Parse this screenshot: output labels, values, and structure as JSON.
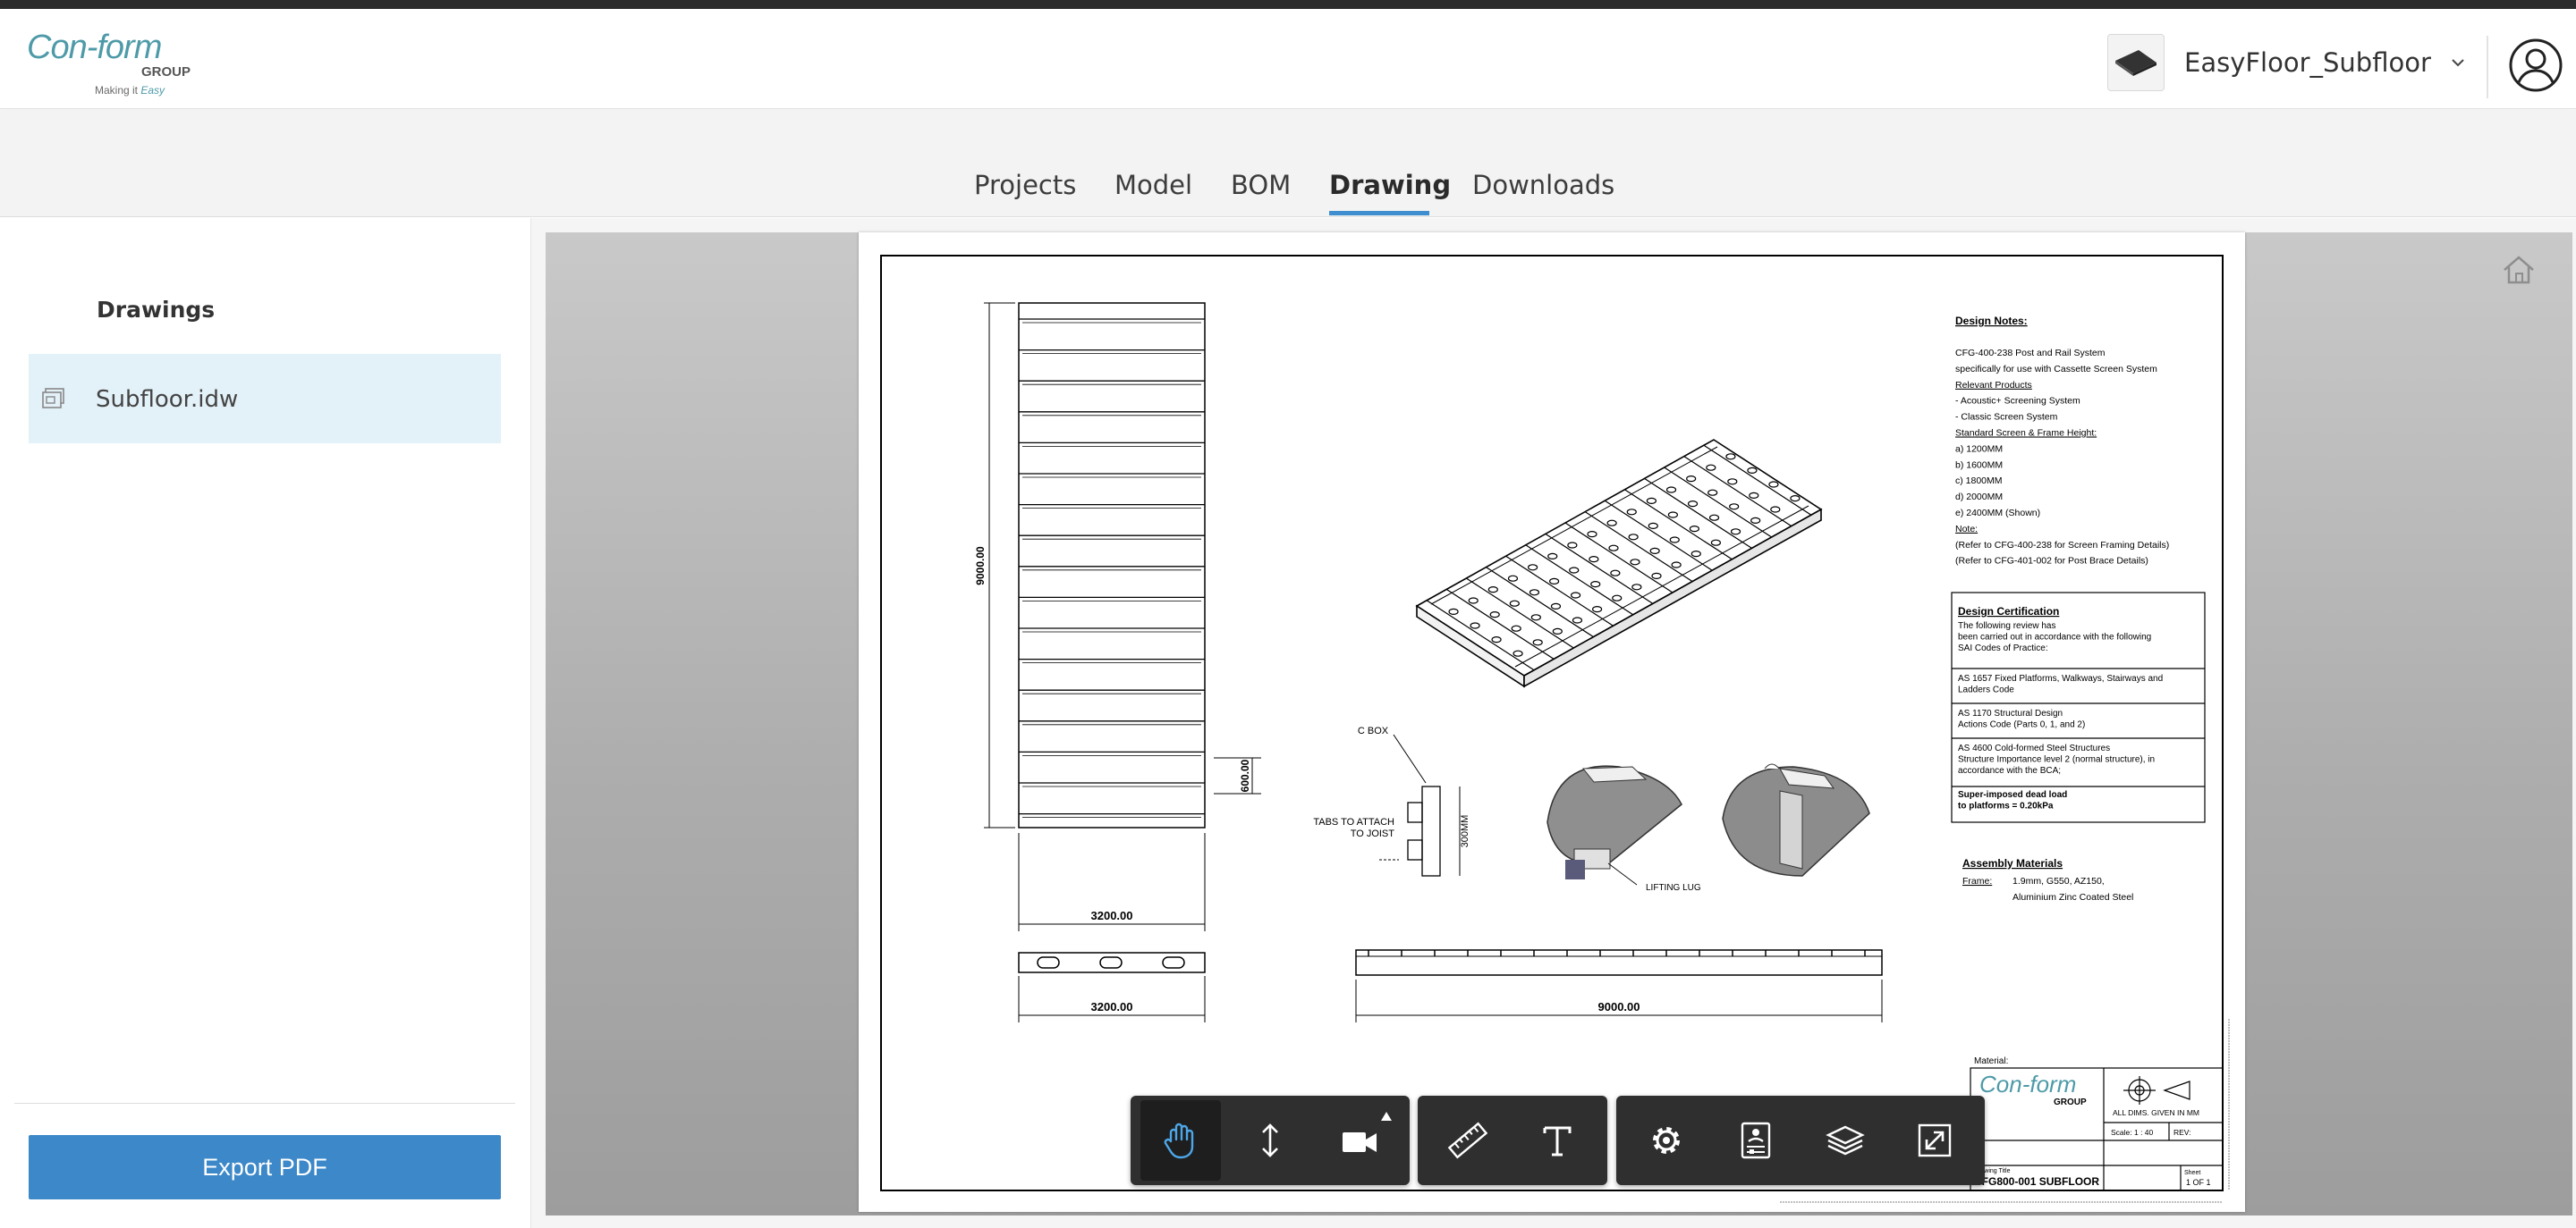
{
  "header": {
    "logo_main": "Con-form",
    "logo_group": "GROUP",
    "logo_tag_a": "Making it",
    "logo_tag_b": "Easy",
    "project_name": "EasyFloor_Subfloor"
  },
  "tabs": [
    {
      "label": "Projects"
    },
    {
      "label": "Model"
    },
    {
      "label": "BOM"
    },
    {
      "label": "Drawing"
    },
    {
      "label": "Downloads"
    }
  ],
  "active_tab": "Drawing",
  "sidebar": {
    "title": "Drawings",
    "items": [
      {
        "label": "Subfloor.idw"
      }
    ],
    "export_label": "Export PDF"
  },
  "drawing": {
    "dim_height": "9000.00",
    "dim_spacing": "600.00",
    "dim_width": "3200.00",
    "dim_width2": "3200.00",
    "dim_length": "9000.00",
    "label_cbox": "C BOX",
    "label_tabs_1": "TABS TO ATTACH",
    "label_tabs_2": "TO JOIST",
    "label_300": "300MM",
    "label_lug": "LIFTING LUG",
    "notes_title": "Design Notes:",
    "notes": [
      "CFG-400-238 Post and Rail System",
      "specifically for use with Cassette Screen System",
      "Relevant Products",
      "- Acoustic+ Screening System",
      "- Classic Screen System",
      "Standard Screen & Frame Height:",
      "a) 1200MM",
      "b) 1600MM",
      "c) 1800MM",
      "d) 2000MM",
      "e) 2400MM (Shown)",
      "Note:",
      "(Refer to CFG-400-238 for Screen Framing Details)",
      "(Refer to CFG-401-002 for Post Brace Details)"
    ],
    "cert_title": "Design Certification",
    "cert_rows": [
      [
        "The following review has",
        "been carried out in accordance with the following",
        "SAI Codes of Practice:"
      ],
      [
        "AS 1657 Fixed Platforms, Walkways, Stairways and",
        "Ladders Code"
      ],
      [
        "AS 1170 Structural Design",
        "Actions Code (Parts 0, 1, and 2)"
      ],
      [
        "AS 4600 Cold-formed Steel Structures",
        "Structure Importance level 2 (normal structure), in",
        "accordance with the BCA;"
      ],
      [
        "Super-imposed dead load",
        "to platforms = 0.20kPa"
      ]
    ],
    "assembly_title": "Assembly Materials",
    "assembly_label": "Frame:",
    "assembly_1": "1.9mm, G550, AZ150,",
    "assembly_2": "Aluminium Zinc Coated Steel",
    "tb_material": "Material:",
    "tb_logo": "Con-form",
    "tb_group": "GROUP",
    "tb_dims": "ALL DIMS. GIVEN IN MM",
    "tb_scale": "Scale: 1 : 40",
    "tb_rev": "REV:",
    "tb_title_label": "Drawing Title",
    "tb_title": "CFG800-001 SUBFLOOR",
    "tb_sheet_label": "Sheet",
    "tb_sheet": "1 OF 1"
  },
  "toolbar": {
    "groups": [
      [
        "pan-icon",
        "dolly-icon",
        "camera-icon"
      ],
      [
        "measure-icon",
        "text-markup-icon"
      ],
      [
        "settings-icon",
        "properties-icon",
        "layers-icon",
        "fullscreen-icon"
      ]
    ],
    "active": "pan-icon"
  },
  "colors": {
    "accent": "#3c88c8",
    "tab_underline": "#3f8fd0",
    "selected_item": "#e3f1f8",
    "toolbar_bg": "#2f2f2f",
    "active_tool": "#4da6e8"
  }
}
